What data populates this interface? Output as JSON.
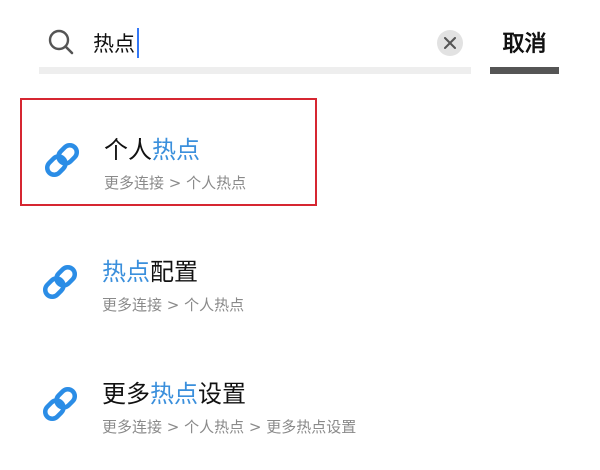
{
  "search": {
    "query": "热点",
    "cancel_label": "取消"
  },
  "results": [
    {
      "title_before": "个人",
      "title_match": "热点",
      "title_after": "",
      "path": "更多连接 > 个人热点"
    },
    {
      "title_before": "",
      "title_match": "热点",
      "title_after": "配置",
      "path": "更多连接 > 个人热点"
    },
    {
      "title_before": "更多",
      "title_match": "热点",
      "title_after": "设置",
      "path": "更多连接 > 个人热点 > 更多热点设置"
    }
  ],
  "colors": {
    "accent": "#3a8fdc",
    "caret": "#3478f6",
    "highlight_border": "#d62631",
    "secondary_text": "#8a8a8a"
  },
  "icons": {
    "search": "search-icon",
    "clear": "clear-icon",
    "result": "link-icon"
  }
}
